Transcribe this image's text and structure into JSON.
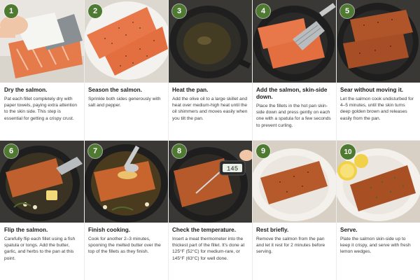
{
  "steps": [
    {
      "num": "1",
      "title": "Dry the salmon.",
      "desc": "Pat each fillet completely dry with paper towels, paying extra attention to the skin side. This step is essential for getting a crispy crust."
    },
    {
      "num": "2",
      "title": "Season the salmon.",
      "desc": "Sprinkle both sides generously with salt and pepper."
    },
    {
      "num": "3",
      "title": "Heat the pan.",
      "desc": "Add the olive oil to a large skillet and heat over medium-high heat until the oil shimmers and moves easily when you tilt the pan."
    },
    {
      "num": "4",
      "title": "Add the salmon, skin-side down.",
      "desc": "Place the fillets in the hot pan skin-side down and press gently on each one with a spatula for a few seconds to prevent curling."
    },
    {
      "num": "5",
      "title": "Sear without moving it.",
      "desc": "Let the salmon cook undisturbed for 4–5 minutes, until the skin turns deep golden brown and releases easily from the pan."
    },
    {
      "num": "6",
      "title": "Flip the salmon.",
      "desc": "Carefully flip each fillet using a fish spatula or tongs. Add the butter, garlic, and herbs to the pan at this point."
    },
    {
      "num": "7",
      "title": "Finish cooking.",
      "desc": "Cook for another 2–3 minutes, spooning the melted butter over the top of the fillets as they finish."
    },
    {
      "num": "8",
      "title": "Check the temperature.",
      "desc": "Insert a meat thermometer into the thickest part of the fillet. It's done at 125°F (52°C) for medium-rare, or 145°F (63°C) for well done."
    },
    {
      "num": "9",
      "title": "Rest briefly.",
      "desc": "Remove the salmon from the pan and let it rest for 2 minutes before serving."
    },
    {
      "num": "10",
      "title": "Serve.",
      "desc": "Plate the salmon skin-side up to keep it crispy, and serve with fresh lemon wedges."
    }
  ],
  "thermometer_reading": "145",
  "colors": {
    "badge": "#4e7a31",
    "salmon": "#e8774a",
    "pan": "#2a2a2a"
  }
}
